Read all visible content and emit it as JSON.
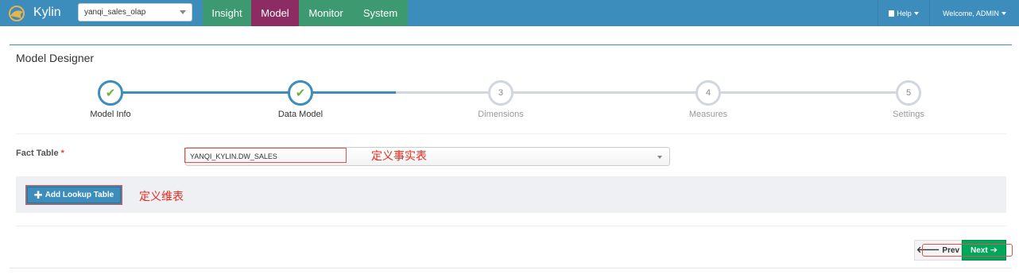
{
  "app": {
    "brand": "Kylin"
  },
  "header": {
    "project_select": "yanqi_sales_olap",
    "tabs": [
      {
        "label": "Insight",
        "color": "#3d9970"
      },
      {
        "label": "Model",
        "color": "#8c2c63"
      },
      {
        "label": "Monitor",
        "color": "#3d9970"
      },
      {
        "label": "System",
        "color": "#3d9970"
      }
    ],
    "help_label": "Help",
    "welcome_label": "Welcome, ADMIN"
  },
  "page": {
    "title": "Model Designer"
  },
  "wizard": {
    "steps": [
      {
        "number": "1",
        "label": "Model Info",
        "done": true
      },
      {
        "number": "2",
        "label": "Data Model",
        "done": true
      },
      {
        "number": "3",
        "label": "Dimensions",
        "done": false
      },
      {
        "number": "4",
        "label": "Measures",
        "done": false
      },
      {
        "number": "5",
        "label": "Settings",
        "done": false
      }
    ]
  },
  "form": {
    "fact_table_label": "Fact Table",
    "required_mark": "*",
    "fact_table_value": "YANQI_KYLIN.DW_SALES",
    "fact_annotation": "定义事实表",
    "add_lookup_label": "Add Lookup Table",
    "lookup_annotation": "定义维表"
  },
  "footer": {
    "prev_label": "Prev",
    "next_label": "Next"
  },
  "icons": {
    "check": "check-icon",
    "plus": "plus-icon",
    "arrow_left": "arrow-left-icon",
    "arrow_right": "arrow-right-icon",
    "book": "book-icon",
    "logo": "kylin-logo"
  },
  "colors": {
    "nav_bg": "#3c8dbc",
    "accent_green": "#00a65a",
    "model_tab": "#8c2c63",
    "annotation_red": "#e8291c"
  }
}
